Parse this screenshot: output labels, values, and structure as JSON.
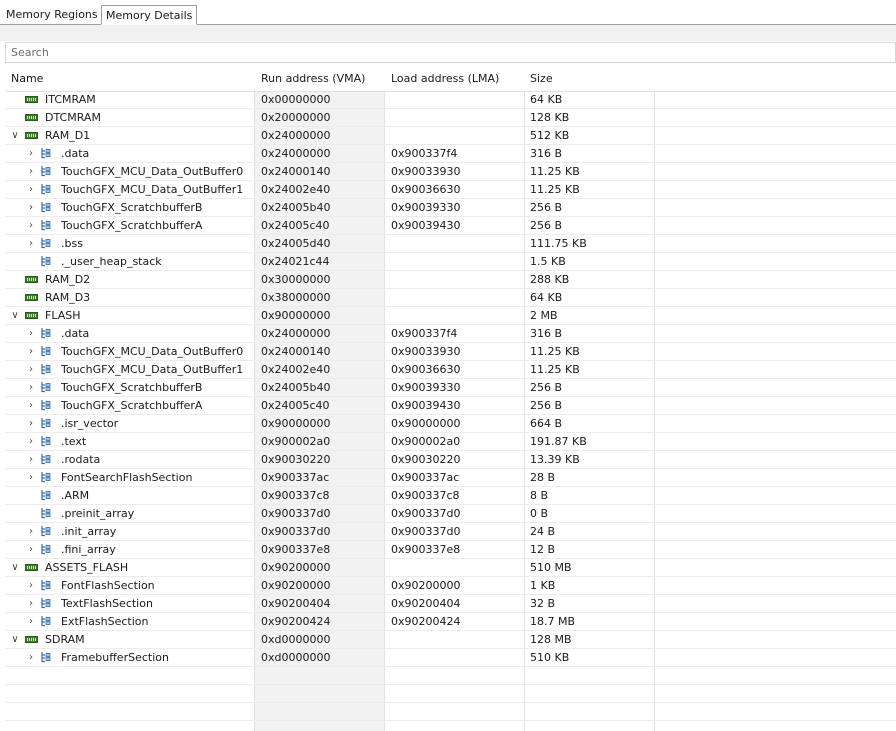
{
  "tabs": [
    {
      "label": "Memory Regions",
      "active": false
    },
    {
      "label": "Memory Details",
      "active": true
    }
  ],
  "search": {
    "placeholder": "Search",
    "value": ""
  },
  "columns": {
    "name": "Name",
    "vma": "Run address (VMA)",
    "lma": "Load address (LMA)",
    "size": "Size"
  },
  "rows": [
    {
      "kind": "region",
      "expand": "none",
      "name": "ITCMRAM",
      "vma": "0x00000000",
      "lma": "",
      "size": "64 KB"
    },
    {
      "kind": "region",
      "expand": "none",
      "name": "DTCMRAM",
      "vma": "0x20000000",
      "lma": "",
      "size": "128 KB"
    },
    {
      "kind": "region",
      "expand": "open",
      "name": "RAM_D1",
      "vma": "0x24000000",
      "lma": "",
      "size": "512 KB"
    },
    {
      "kind": "section",
      "expand": "closed",
      "name": ".data",
      "vma": "0x24000000",
      "lma": "0x900337f4",
      "size": "316 B"
    },
    {
      "kind": "section",
      "expand": "closed",
      "name": "TouchGFX_MCU_Data_OutBuffer0",
      "vma": "0x24000140",
      "lma": "0x90033930",
      "size": "11.25 KB"
    },
    {
      "kind": "section",
      "expand": "closed",
      "name": "TouchGFX_MCU_Data_OutBuffer1",
      "vma": "0x24002e40",
      "lma": "0x90036630",
      "size": "11.25 KB"
    },
    {
      "kind": "section",
      "expand": "closed",
      "name": "TouchGFX_ScratchbufferB",
      "vma": "0x24005b40",
      "lma": "0x90039330",
      "size": "256 B"
    },
    {
      "kind": "section",
      "expand": "closed",
      "name": "TouchGFX_ScratchbufferA",
      "vma": "0x24005c40",
      "lma": "0x90039430",
      "size": "256 B"
    },
    {
      "kind": "section",
      "expand": "closed",
      "name": ".bss",
      "vma": "0x24005d40",
      "lma": "",
      "size": "111.75 KB"
    },
    {
      "kind": "section",
      "expand": "none",
      "name": "._user_heap_stack",
      "vma": "0x24021c44",
      "lma": "",
      "size": "1.5 KB"
    },
    {
      "kind": "region",
      "expand": "none",
      "name": "RAM_D2",
      "vma": "0x30000000",
      "lma": "",
      "size": "288 KB"
    },
    {
      "kind": "region",
      "expand": "none",
      "name": "RAM_D3",
      "vma": "0x38000000",
      "lma": "",
      "size": "64 KB"
    },
    {
      "kind": "region",
      "expand": "open",
      "name": "FLASH",
      "vma": "0x90000000",
      "lma": "",
      "size": "2 MB"
    },
    {
      "kind": "section",
      "expand": "closed",
      "name": ".data",
      "vma": "0x24000000",
      "lma": "0x900337f4",
      "size": "316 B"
    },
    {
      "kind": "section",
      "expand": "closed",
      "name": "TouchGFX_MCU_Data_OutBuffer0",
      "vma": "0x24000140",
      "lma": "0x90033930",
      "size": "11.25 KB"
    },
    {
      "kind": "section",
      "expand": "closed",
      "name": "TouchGFX_MCU_Data_OutBuffer1",
      "vma": "0x24002e40",
      "lma": "0x90036630",
      "size": "11.25 KB"
    },
    {
      "kind": "section",
      "expand": "closed",
      "name": "TouchGFX_ScratchbufferB",
      "vma": "0x24005b40",
      "lma": "0x90039330",
      "size": "256 B"
    },
    {
      "kind": "section",
      "expand": "closed",
      "name": "TouchGFX_ScratchbufferA",
      "vma": "0x24005c40",
      "lma": "0x90039430",
      "size": "256 B"
    },
    {
      "kind": "section",
      "expand": "closed",
      "name": ".isr_vector",
      "vma": "0x90000000",
      "lma": "0x90000000",
      "size": "664 B"
    },
    {
      "kind": "section",
      "expand": "closed",
      "name": ".text",
      "vma": "0x900002a0",
      "lma": "0x900002a0",
      "size": "191.87 KB"
    },
    {
      "kind": "section",
      "expand": "closed",
      "name": ".rodata",
      "vma": "0x90030220",
      "lma": "0x90030220",
      "size": "13.39 KB"
    },
    {
      "kind": "section",
      "expand": "closed",
      "name": "FontSearchFlashSection",
      "vma": "0x900337ac",
      "lma": "0x900337ac",
      "size": "28 B"
    },
    {
      "kind": "section",
      "expand": "none",
      "name": ".ARM",
      "vma": "0x900337c8",
      "lma": "0x900337c8",
      "size": "8 B"
    },
    {
      "kind": "section",
      "expand": "none",
      "name": ".preinit_array",
      "vma": "0x900337d0",
      "lma": "0x900337d0",
      "size": "0 B"
    },
    {
      "kind": "section",
      "expand": "closed",
      "name": ".init_array",
      "vma": "0x900337d0",
      "lma": "0x900337d0",
      "size": "24 B"
    },
    {
      "kind": "section",
      "expand": "closed",
      "name": ".fini_array",
      "vma": "0x900337e8",
      "lma": "0x900337e8",
      "size": "12 B"
    },
    {
      "kind": "region",
      "expand": "open",
      "name": "ASSETS_FLASH",
      "vma": "0x90200000",
      "lma": "",
      "size": "510 MB"
    },
    {
      "kind": "section",
      "expand": "closed",
      "name": "FontFlashSection",
      "vma": "0x90200000",
      "lma": "0x90200000",
      "size": "1 KB"
    },
    {
      "kind": "section",
      "expand": "closed",
      "name": "TextFlashSection",
      "vma": "0x90200404",
      "lma": "0x90200404",
      "size": "32 B"
    },
    {
      "kind": "section",
      "expand": "closed",
      "name": "ExtFlashSection",
      "vma": "0x90200424",
      "lma": "0x90200424",
      "size": "18.7 MB"
    },
    {
      "kind": "region",
      "expand": "open",
      "name": "SDRAM",
      "vma": "0xd0000000",
      "lma": "",
      "size": "128 MB"
    },
    {
      "kind": "section",
      "expand": "closed",
      "name": "FramebufferSection",
      "vma": "0xd0000000",
      "lma": "",
      "size": "510 KB"
    }
  ],
  "empty_rows": 4
}
